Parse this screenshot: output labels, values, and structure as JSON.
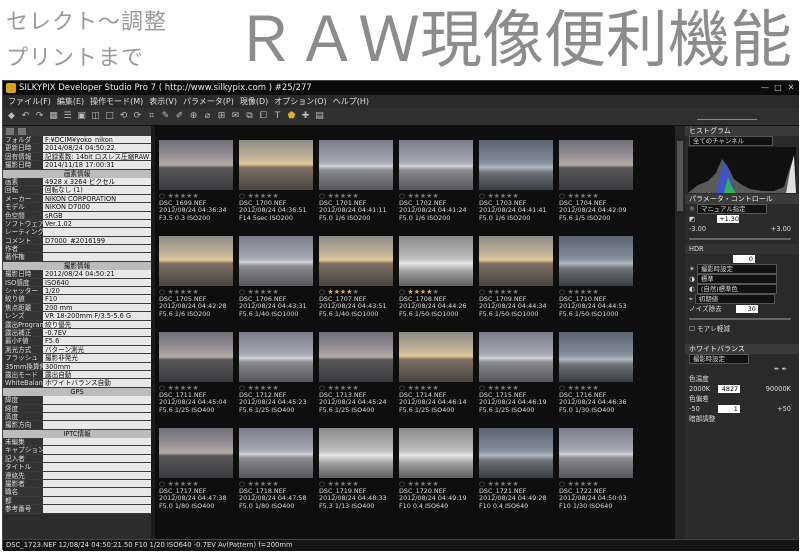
{
  "banner": {
    "line1": "セレクト〜調整",
    "line2": "プリントまで",
    "title": "ＲＡＷ現像便利機能"
  },
  "window": {
    "title": "SILKYPIX Developer Studio Pro 7 ( http://www.silkypix.com )   #25/277"
  },
  "menu": [
    "ファイル(F)",
    "編集(E)",
    "操作モード(M)",
    "表示(V)",
    "パラメータ(P)",
    "現像(D)",
    "オプション(O)",
    "ヘルプ(H)"
  ],
  "left_panel": {
    "rows1": [
      [
        "フォルダ",
        "F:¥DCIM¥yoko_nikon"
      ],
      [
        "更新日時",
        "2014/08/24 04:50:22"
      ],
      [
        "固有情報",
        "記録素数: 14bit ロスレス圧縮RAW"
      ],
      [
        "撮影日時",
        "2014/11/18 17:00:31"
      ]
    ],
    "sec1": "画素情報",
    "rows2": [
      [
        "画素",
        "4928 x 3264 ピクセル"
      ],
      [
        "回転",
        "回転なし (1)"
      ],
      [
        "メーカー",
        "NIKON CORPORATION"
      ],
      [
        "モデル",
        "NIKON D7000"
      ],
      [
        "色空間",
        "sRGB"
      ],
      [
        "ソフトウェア",
        "Ver.1.02"
      ],
      [
        "レーティング",
        ""
      ],
      [
        "コメント",
        "D7000_#2016199"
      ],
      [
        "作者",
        ""
      ],
      [
        "著作権",
        ""
      ]
    ],
    "sec2": "撮影情報",
    "rows3": [
      [
        "撮影日時",
        "2012/08/24 04:50:21"
      ],
      [
        "ISO感度",
        "ISO640"
      ],
      [
        "シャッター",
        "1/20"
      ],
      [
        "絞り値",
        "F10"
      ],
      [
        "焦点距離",
        "200 mm"
      ],
      [
        "レンズ",
        "VR 18-200mm F/3.5-5.6 G"
      ],
      [
        "露出Program",
        "絞り優先"
      ],
      [
        "露出補正",
        "-0.7EV"
      ],
      [
        "最小F値",
        "F5.6"
      ],
      [
        "測光方式",
        "パターン測光"
      ],
      [
        "フラッシュ",
        "撮影非発光"
      ],
      [
        "35mm換算焦点距離",
        "300mm"
      ],
      [
        "露出モード",
        "露出自動"
      ],
      [
        "WhiteBalance",
        "ホワイトバランス自動"
      ]
    ],
    "sec3": "GPS",
    "rows4": [
      [
        "緯度",
        ""
      ],
      [
        "経度",
        ""
      ],
      [
        "高度",
        ""
      ],
      [
        "撮影方向",
        ""
      ]
    ],
    "sec4": "IPTC情報",
    "rows5": [
      [
        "未編集",
        ""
      ],
      [
        "キャプション",
        ""
      ],
      [
        "記入者",
        ""
      ],
      [
        "タイトル",
        ""
      ],
      [
        "連絡先",
        ""
      ],
      [
        "撮影者",
        ""
      ],
      [
        "職名",
        ""
      ],
      [
        "都",
        ""
      ],
      [
        "参考番号",
        ""
      ]
    ]
  },
  "thumbs": [
    [
      "DSC_1699.NEF",
      "2012/08/24 04:36:34",
      "F3.5 0.3 ISO200",
      "a",
      0
    ],
    [
      "DSC_1700.NEF",
      "2012/08/24 04:36:51",
      "F14 5sec ISO200",
      "b",
      0
    ],
    [
      "DSC_1701.NEF",
      "2012/08/24 04:41:11",
      "F5.0 1/6 ISO200",
      "c",
      0
    ],
    [
      "DSC_1702.NEF",
      "2012/08/24 04:41:24",
      "F5.0 1/6 ISO200",
      "c",
      0
    ],
    [
      "DSC_1703.NEF",
      "2012/08/24 04:41:41",
      "F5.0 1/6 ISO200",
      "d",
      0
    ],
    [
      "DSC_1704.NEF",
      "2012/08/24 04:42:09",
      "F5.6 1/5 ISO200",
      "a",
      0
    ],
    [
      "DSC_1705.NEF",
      "2012/08/24 04:42:28",
      "F5.6 1/6 ISO200",
      "b",
      0
    ],
    [
      "DSC_1706.NEF",
      "2012/08/24 04:43:31",
      "F5.6 1/40 ISO1000",
      "c",
      0
    ],
    [
      "DSC_1707.NEF",
      "2012/08/24 04:43:51",
      "F5.6 1/40 ISO1000",
      "b",
      4
    ],
    [
      "DSC_1708.NEF",
      "2012/08/24 04:44:26",
      "F5.6 1/50 ISO1000",
      "e",
      4
    ],
    [
      "DSC_1709.NEF",
      "2012/08/24 04:44:34",
      "F5.6 1/50 ISO1000",
      "b",
      0
    ],
    [
      "DSC_1710.NEF",
      "2012/08/24 04:44:53",
      "F5.6 1/50 ISO1000",
      "d",
      0
    ],
    [
      "DSC_1711.NEF",
      "2012/08/24 04:45:04",
      "F5.6 1/25 ISO400",
      "a",
      0
    ],
    [
      "DSC_1712.NEF",
      "2012/08/24 04:45:23",
      "F5.6 1/25 ISO400",
      "c",
      0
    ],
    [
      "DSC_1713.NEF",
      "2012/08/24 04:45:24",
      "F5.6 1/25 ISO400",
      "a",
      0
    ],
    [
      "DSC_1714.NEF",
      "2012/08/24 04:46:14",
      "F5.6 1/25 ISO400",
      "b",
      0
    ],
    [
      "DSC_1715.NEF",
      "2012/08/24 04:46:19",
      "F5.6 1/25 ISO400",
      "c",
      0
    ],
    [
      "DSC_1716.NEF",
      "2012/08/24 04:46:36",
      "F5.0 1/30 ISO400",
      "d",
      0
    ],
    [
      "DSC_1717.NEF",
      "2012/08/24 04:47:38",
      "F5.0 1/80 ISO400",
      "a",
      0
    ],
    [
      "DSC_1718.NEF",
      "2012/08/24 04:47:58",
      "F5.0 1/80 ISO400",
      "c",
      0
    ],
    [
      "DSC_1719.NEF",
      "2012/08/24 04:48:33",
      "F5.3 1/13 ISO400",
      "e",
      0
    ],
    [
      "DSC_1720.NEF",
      "2012/08/24 04:49:19",
      "F10 0.4 ISO640",
      "e",
      0
    ],
    [
      "DSC_1721.NEF",
      "2012/08/24 04:49:28",
      "F10 0.4 ISO640",
      "d",
      0
    ],
    [
      "DSC_1722.NEF",
      "2012/08/24 04:50:03",
      "F10 1/30 ISO640",
      "c",
      0
    ]
  ],
  "right_panel": {
    "histogram": "ヒストグラム",
    "channel": "全てのチャンネル",
    "param": "パラメータ・コントロール",
    "exposure_mode": "マニュアル指定",
    "exposure_val": "+1.30",
    "range_min": "-3.00",
    "range_max": "+3.00",
    "hdr": "HDR",
    "hdr_val": "0",
    "preset1": "撮影時設定",
    "preset2": "標準",
    "preset3": "(自然)標準色",
    "preset4": "初期値",
    "noise": "ノイズ除去",
    "noise_val": "30",
    "moire": "モアレ軽減",
    "wb_title": "ホワイトバランス",
    "wb_mode": "撮影時設定",
    "temp": "色温度",
    "temp_val": "4827",
    "temp_min": "2000K",
    "temp_max": "90000K",
    "tint": "色偏差",
    "tint_val": "1",
    "tint_min": "-50",
    "tint_max": "+50",
    "dark": "暗部調整"
  },
  "status": "DSC_1723.NEF 12/08/24 04:50:21.50 F10 1/20 ISO640 -0.7EV Av(Pattern) f=200mm",
  "colors": {
    "star": "#d8b020",
    "bg": "#1b1b1b"
  }
}
